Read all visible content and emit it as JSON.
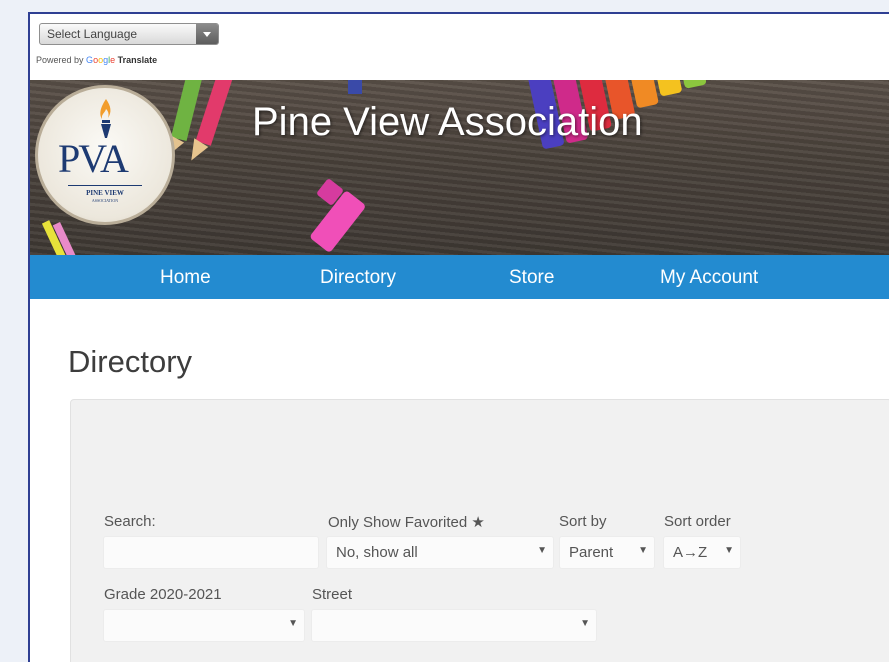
{
  "translate": {
    "select_label": "Select Language",
    "powered_prefix": "Powered by",
    "google_g": "G",
    "google_o1": "o",
    "google_o2": "o",
    "google_g2": "g",
    "google_l": "l",
    "google_e": "e",
    "translate_word": "Translate"
  },
  "header": {
    "site_title": "Pine View Association",
    "logo": {
      "letters": "PVA",
      "line1": "PINE VIEW",
      "line2": "ASSOCIATION"
    }
  },
  "nav": {
    "items": [
      "Home",
      "Directory",
      "Store",
      "My Account"
    ]
  },
  "page": {
    "title": "Directory"
  },
  "filters": {
    "search_label": "Search:",
    "search_value": "",
    "favorited_label": "Only Show Favorited ★",
    "favorited_value": "No, show all",
    "sort_by_label": "Sort by",
    "sort_by_value": "Parent",
    "sort_order_label": "Sort order",
    "sort_order_value": "A→Z",
    "grade_label": "Grade 2020-2021",
    "grade_value": "",
    "street_label": "Street",
    "street_value": "",
    "caret": "▼"
  },
  "colors": {
    "nav_bg": "#238bd0",
    "frame_border": "#2f3f93",
    "logo_navy": "#1d3a72"
  }
}
